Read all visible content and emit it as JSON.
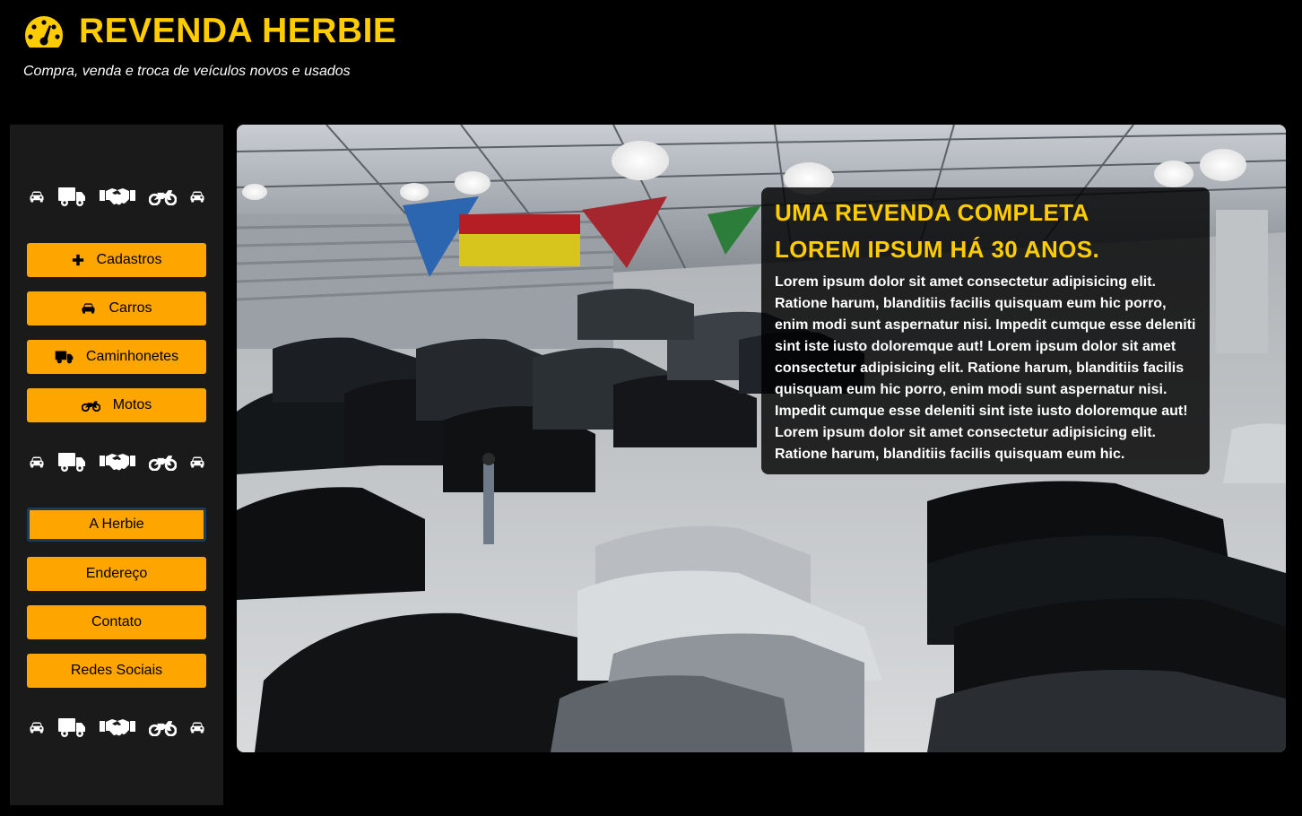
{
  "header": {
    "logo_icon": "speedometer-icon",
    "title": "REVENDA HERBIE",
    "subtitle": "Compra, venda e troca de veículos novos e usados",
    "accent_color": "#FFCC00"
  },
  "sidebar": {
    "icon_row_icons": [
      "car-icon",
      "truck-icon",
      "handshake-icon",
      "motorcycle-icon",
      "car-icon"
    ],
    "vehicle_menu": [
      {
        "label": "Cadastros",
        "icon": "plus-icon"
      },
      {
        "label": "Carros",
        "icon": "car-icon"
      },
      {
        "label": "Caminhonetes",
        "icon": "truck-icon"
      },
      {
        "label": "Motos",
        "icon": "motorcycle-icon"
      }
    ],
    "info_menu": [
      {
        "label": "A Herbie"
      },
      {
        "label": "Endereço"
      },
      {
        "label": "Contato"
      },
      {
        "label": "Redes Sociais"
      }
    ],
    "button_color": "#FFA500"
  },
  "hero": {
    "heading_line1": "UMA REVENDA COMPLETA",
    "heading_line2": "LOREM IPSUM HÁ 30 ANOS.",
    "body": "Lorem ipsum dolor sit amet consectetur adipisicing elit. Ratione harum, blanditiis facilis quisquam eum hic porro, enim modi sunt aspernatur nisi. Impedit cumque esse deleniti sint iste iusto doloremque aut! Lorem ipsum dolor sit amet consectetur adipisicing elit. Ratione harum, blanditiis facilis quisquam eum hic porro, enim modi sunt aspernatur nisi. Impedit cumque esse deleniti sint iste iusto doloremque aut! Lorem ipsum dolor sit amet consectetur adipisicing elit. Ratione harum, blanditiis facilis quisquam eum hic."
  }
}
